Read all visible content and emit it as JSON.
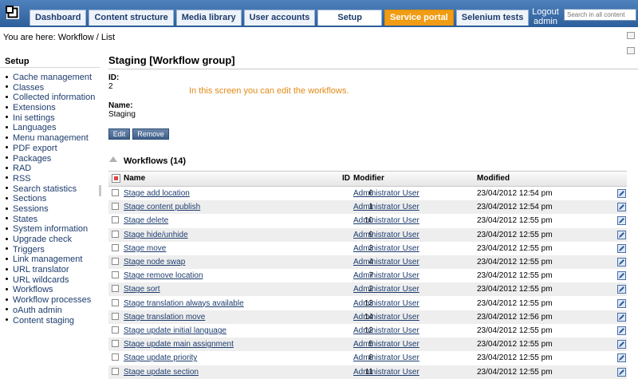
{
  "header": {
    "tabs": [
      "Dashboard",
      "Content structure",
      "Media library",
      "User accounts",
      "Setup",
      "Service portal",
      "Selenium tests"
    ],
    "logout_label": "Logout admin",
    "search_placeholder": "Search in all content",
    "logo_icon": "ez-logo-icon"
  },
  "breadcrumb": "You are here: Workflow / List",
  "left_menu": {
    "title": "Setup",
    "items": [
      "Cache management",
      "Classes",
      "Collected information",
      "Extensions",
      "Ini settings",
      "Languages",
      "Menu management",
      "PDF export",
      "Packages",
      "RAD",
      "RSS",
      "Search statistics",
      "Sections",
      "Sessions",
      "States",
      "System information",
      "Upgrade check",
      "Triggers",
      "Link management",
      "URL translator",
      "URL wildcards",
      "Workflows",
      "Workflow processes",
      "oAuth admin",
      "Content staging"
    ]
  },
  "main": {
    "title": "Staging [Workflow group]",
    "id_label": "ID:",
    "id_value": "2",
    "name_label": "Name:",
    "name_value": "Staging",
    "hint": "In this screen you can edit the workflows.",
    "edit_button": "Edit",
    "remove_button": "Remove",
    "workflows_title": "Workflows (14)"
  },
  "table": {
    "columns": {
      "name": "Name",
      "id": "ID",
      "modifier": "Modifier",
      "modified": "Modified"
    },
    "rows": [
      {
        "name": "Stage add location",
        "id": "6",
        "modifier": "Administrator User",
        "modified": "23/04/2012 12:54 pm"
      },
      {
        "name": "Stage content publish",
        "id": "1",
        "modifier": "Administrator User",
        "modified": "23/04/2012 12:54 pm"
      },
      {
        "name": "Stage delete",
        "id": "10",
        "modifier": "Administrator User",
        "modified": "23/04/2012 12:55 pm"
      },
      {
        "name": "Stage hide/unhide",
        "id": "9",
        "modifier": "Administrator User",
        "modified": "23/04/2012 12:55 pm"
      },
      {
        "name": "Stage move",
        "id": "3",
        "modifier": "Administrator User",
        "modified": "23/04/2012 12:55 pm"
      },
      {
        "name": "Stage node swap",
        "id": "4",
        "modifier": "Administrator User",
        "modified": "23/04/2012 12:55 pm"
      },
      {
        "name": "Stage remove location",
        "id": "7",
        "modifier": "Administrator User",
        "modified": "23/04/2012 12:55 pm"
      },
      {
        "name": "Stage sort",
        "id": "2",
        "modifier": "Administrator User",
        "modified": "23/04/2012 12:55 pm"
      },
      {
        "name": "Stage translation always available",
        "id": "13",
        "modifier": "Administrator User",
        "modified": "23/04/2012 12:55 pm"
      },
      {
        "name": "Stage translation move",
        "id": "14",
        "modifier": "Administrator User",
        "modified": "23/04/2012 12:56 pm"
      },
      {
        "name": "Stage update initial language",
        "id": "12",
        "modifier": "Administrator User",
        "modified": "23/04/2012 12:55 pm"
      },
      {
        "name": "Stage update main assignment",
        "id": "5",
        "modifier": "Administrator User",
        "modified": "23/04/2012 12:55 pm"
      },
      {
        "name": "Stage update priority",
        "id": "8",
        "modifier": "Administrator User",
        "modified": "23/04/2012 12:55 pm"
      },
      {
        "name": "Stage update section",
        "id": "11",
        "modifier": "Administrator User",
        "modified": "23/04/2012 12:55 pm"
      }
    ]
  },
  "colors": {
    "topbar": "#2c5e9b",
    "portal_tab": "#f09c14",
    "hint": "#e28a18",
    "link": "#1d3c6d"
  }
}
